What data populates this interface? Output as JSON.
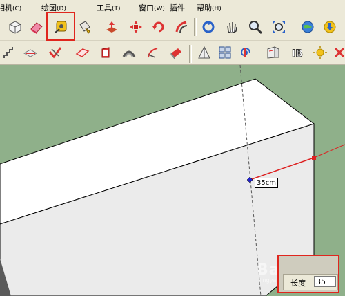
{
  "menu": {
    "items": [
      {
        "label": "相机",
        "key": "(C)"
      },
      {
        "label": "绘图",
        "key": "(D)"
      },
      {
        "label": "工具",
        "key": "(T)"
      },
      {
        "label": "窗口",
        "key": "(W)"
      },
      {
        "label": "插件",
        "key": ""
      },
      {
        "label": "帮助",
        "key": "(H)"
      }
    ]
  },
  "toolbar1": {
    "tools": [
      "component-icon",
      "eraser-icon",
      "tape-measure-icon",
      "paint-bucket-icon",
      "push-pull-icon",
      "move-icon",
      "rotate-icon",
      "offset-icon",
      "orbit-icon",
      "pan-icon",
      "zoom-icon",
      "zoom-extents-icon",
      "get-models-icon",
      "share-model-icon"
    ],
    "selected": "tape-measure-icon"
  },
  "toolbar2": {
    "tools": [
      "stairs-icon",
      "flip-icon",
      "check-icon",
      "plane-icon",
      "follow-me-icon",
      "arc-tool-icon",
      "fillet-icon",
      "red-face-icon",
      "tri-icon",
      "cube-grid-icon",
      "spiral-icon",
      "wall-icon",
      "ib-icon",
      "sun-icon",
      "x-icon"
    ]
  },
  "viewport": {
    "tooltip": "35cm",
    "colors": {
      "background": "#8fb08a",
      "box_top": "#ffffff",
      "box_side": "#ebebeb",
      "guide_line": "#dd2222",
      "tape_point": "#2222cc"
    }
  },
  "vcb": {
    "label": "长度",
    "value": "35"
  },
  "watermark": {
    "text": "Bai经验",
    "sub": "jingyan.baidu.com"
  }
}
